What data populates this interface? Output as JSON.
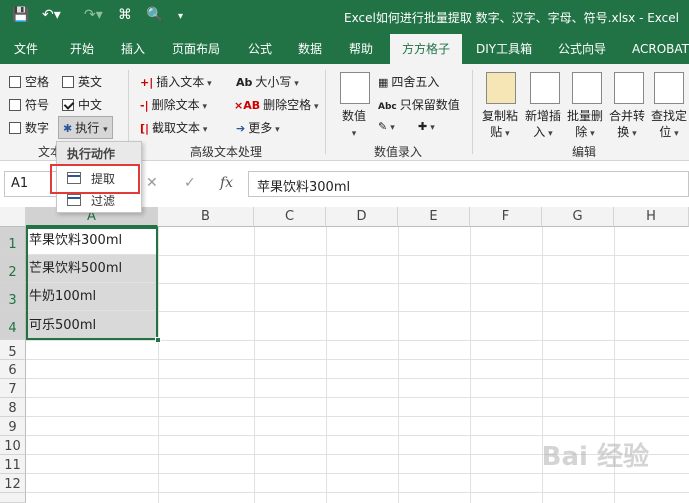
{
  "window": {
    "title": "Excel如何进行批量提取 数字、汉字、字母、符号.xlsx  -  Excel"
  },
  "tabs": [
    "文件",
    "开始",
    "插入",
    "页面布局",
    "公式",
    "数据",
    "帮助",
    "方方格子",
    "DIY工具箱",
    "公式向导",
    "ACROBAT"
  ],
  "active_tab": "方方格子",
  "ribbon": {
    "checkboxes": [
      {
        "label": "空格",
        "checked": false
      },
      {
        "label": "英文",
        "checked": false
      },
      {
        "label": "符号",
        "checked": false
      },
      {
        "label": "中文",
        "checked": true
      },
      {
        "label": "数字",
        "checked": false
      }
    ],
    "execute_label": "执行",
    "group_text_label": "文本",
    "advanced": {
      "insert": "插入文本",
      "delete": "删除文本",
      "extract": "截取文本",
      "case": "大小写",
      "delete_space": "删除空格",
      "more": "更多",
      "group_label": "高级文本处理"
    },
    "numeric": {
      "value_label": "数值",
      "round": "四舍五入",
      "keep_value": "只保留数值",
      "group_label": "数值录入"
    },
    "edit": {
      "copy_paste": [
        "复制粘",
        "贴"
      ],
      "insert_new": [
        "新增插",
        "入"
      ],
      "batch_delete": [
        "批量删",
        "除"
      ],
      "merge": [
        "合并转",
        "换"
      ],
      "find": [
        "查找定",
        "位"
      ],
      "group_label": "编辑"
    }
  },
  "dropdown": {
    "header": "执行动作",
    "items": [
      "提取",
      "过滤"
    ]
  },
  "formula_bar": {
    "name_box": "A1",
    "fx": "fx",
    "value": "苹果饮料300ml"
  },
  "grid": {
    "columns": [
      "A",
      "B",
      "C",
      "D",
      "E",
      "F",
      "G",
      "H"
    ],
    "rows": [
      "1",
      "2",
      "3",
      "4",
      "5",
      "6",
      "7",
      "8",
      "9",
      "10",
      "11",
      "12"
    ],
    "cells_A": [
      "苹果饮料300ml",
      "芒果饮料500ml",
      "牛奶100ml",
      "可乐500ml"
    ]
  },
  "watermark": "Bai 经验",
  "colors": {
    "accent": "#217346",
    "highlight": "#e03a3a"
  }
}
